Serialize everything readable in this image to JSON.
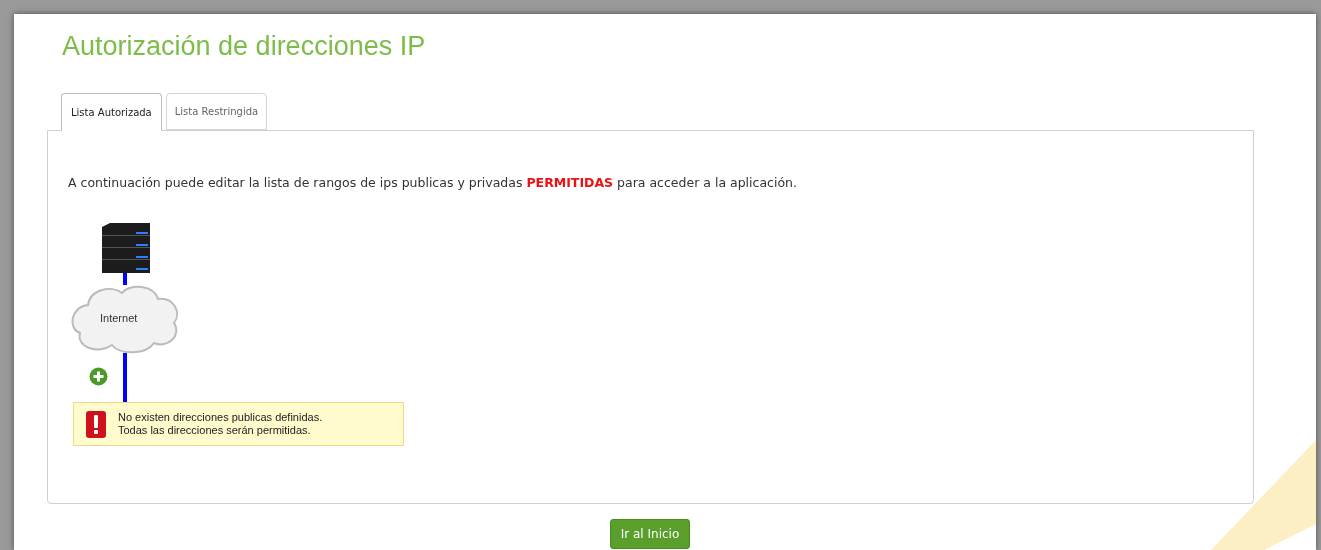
{
  "title": "Autorización de direcciones IP",
  "tabs": [
    {
      "label": "Lista Autorizada",
      "selected": true
    },
    {
      "label": "Lista Restringida",
      "selected": false
    }
  ],
  "intro": "A continuación puede editar la lista de rangos de ips publicas y privadas **PERMITIDAS** para acceder a la aplicación.",
  "diagram": {
    "cloud_label": "Internet",
    "warning_lines": [
      "No existen direcciones publicas definidas.",
      "Todas las direcciones serán permitidas."
    ]
  },
  "button": "Ir al Inicio"
}
